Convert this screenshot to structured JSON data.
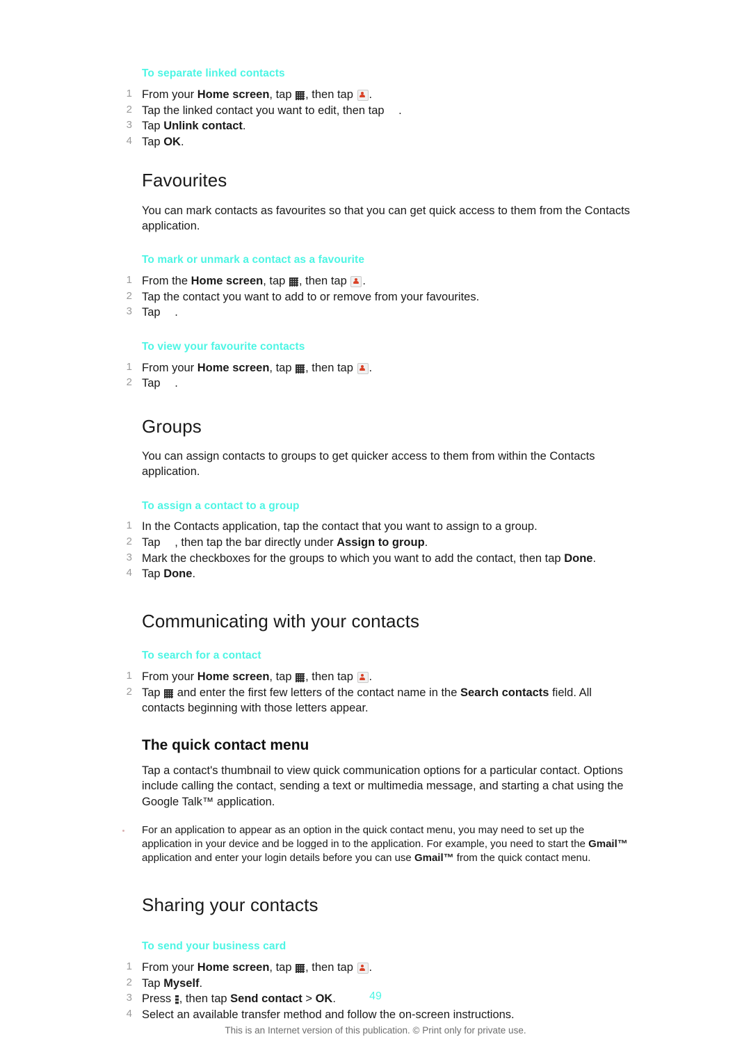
{
  "document": {
    "page_number": "49",
    "footer_note": "This is an Internet version of this publication. © Print only for private use.",
    "accent_color": "#4DF5E4"
  },
  "sections": {
    "separate_linked": {
      "heading": "To separate linked contacts",
      "steps": [
        {
          "num": "1",
          "pre": "From your ",
          "bold1": "Home screen",
          "mid": ", tap ",
          "icon1": "grid-icon",
          "mid2": ", then tap ",
          "icon2": "contacts-icon",
          "post": "."
        },
        {
          "num": "2",
          "text_a": "Tap the linked contact you want to edit, then tap ",
          "icon": "missing-glyph",
          "text_b": "."
        },
        {
          "num": "3",
          "pre": "Tap ",
          "bold": "Unlink contact",
          "post": "."
        },
        {
          "num": "4",
          "pre": "Tap ",
          "bold": "OK",
          "post": "."
        }
      ]
    },
    "favourites": {
      "heading": "Favourites",
      "body": "You can mark contacts as favourites so that you can get quick access to them from the Contacts application.",
      "mark_unmark": {
        "heading": "To mark or unmark a contact as a favourite",
        "steps": [
          {
            "num": "1",
            "pre": "From the ",
            "bold1": "Home screen",
            "mid": ", tap ",
            "icon1": "grid-icon",
            "mid2": ", then tap ",
            "icon2": "contacts-icon",
            "post": "."
          },
          {
            "num": "2",
            "text": "Tap the contact you want to add to or remove from your favourites."
          },
          {
            "num": "3",
            "pre": "Tap ",
            "icon": "missing-glyph",
            "post": "."
          }
        ]
      },
      "view_favourites": {
        "heading": "To view your favourite contacts",
        "steps": [
          {
            "num": "1",
            "pre": "From your ",
            "bold1": "Home screen",
            "mid": ", tap ",
            "icon1": "grid-icon",
            "mid2": ", then tap ",
            "icon2": "contacts-icon",
            "post": "."
          },
          {
            "num": "2",
            "pre": "Tap ",
            "icon": "missing-glyph",
            "post": "."
          }
        ]
      }
    },
    "groups": {
      "heading": "Groups",
      "body": "You can assign contacts to groups to get quicker access to them from within the Contacts application.",
      "assign_to_group": {
        "heading": "To assign a contact to a group",
        "steps": [
          {
            "num": "1",
            "text": "In the Contacts application, tap the contact that you want to assign to a group."
          },
          {
            "num": "2",
            "pre": "Tap ",
            "icon": "missing-glyph",
            "mid": ", then tap the bar directly under ",
            "bold": "Assign to group",
            "post": "."
          },
          {
            "num": "3",
            "pre": "Mark the checkboxes for the groups to which you want to add the contact, then tap ",
            "bold": "Done",
            "post": "."
          },
          {
            "num": "4",
            "pre": "Tap ",
            "bold": "Done",
            "post": "."
          }
        ]
      }
    },
    "communicating": {
      "heading": "Communicating with your contacts",
      "search_contact": {
        "heading": "To search for a contact",
        "steps": [
          {
            "num": "1",
            "pre": "From your ",
            "bold1": "Home screen",
            "mid": ", tap ",
            "icon1": "grid-icon",
            "mid2": ", then tap ",
            "icon2": "contacts-icon",
            "post": "."
          },
          {
            "num": "2",
            "pre": "Tap ",
            "icon": "grid-icon",
            "mid": " and enter the first few letters of the contact name in the ",
            "bold1": "Search contacts",
            "post": " field. All contacts beginning with those letters appear."
          }
        ]
      },
      "quick_contact_menu": {
        "heading": "The quick contact menu",
        "body": "Tap a contact's thumbnail to view quick communication options for a particular contact. Options include calling the contact, sending a text or multimedia message, and starting a chat using the Google Talk™ application.",
        "note_pre": "For an application to appear as an option in the quick contact menu, you may need to set up the application in your device and be logged in to the application. For example, you need to start the ",
        "note_bold1": "Gmail™",
        "note_mid": " application and enter your login details before you can use ",
        "note_bold2": "Gmail™",
        "note_post": " from the quick contact menu."
      }
    },
    "sharing": {
      "heading": "Sharing your contacts",
      "business_card": {
        "heading": "To send your business card",
        "steps": [
          {
            "num": "1",
            "pre": "From your ",
            "bold1": "Home screen",
            "mid": ", tap ",
            "icon1": "grid-icon",
            "mid2": ", then tap ",
            "icon2": "contacts-icon",
            "post": "."
          },
          {
            "num": "2",
            "pre": "Tap ",
            "bold": "Myself",
            "post": "."
          },
          {
            "num": "3",
            "pre": "Press ",
            "icon": "menu-key-icon",
            "mid": ", then tap ",
            "bold": "Send contact",
            "mid2": " > ",
            "bold2": "OK",
            "post": "."
          },
          {
            "num": "4",
            "text": "Select an available transfer method and follow the on-screen instructions."
          }
        ]
      }
    }
  }
}
